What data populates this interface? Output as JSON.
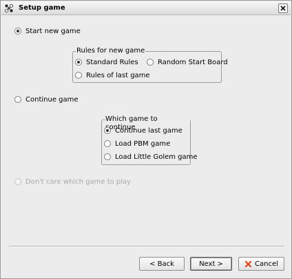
{
  "window": {
    "title": "Setup game"
  },
  "start_new": {
    "label": "Start new game",
    "selected": true
  },
  "rules_group": {
    "title": "Rules for new game",
    "options": [
      {
        "label": "Standard Rules",
        "selected": true
      },
      {
        "label": "Random Start Board",
        "selected": false
      },
      {
        "label": "Rules of last game",
        "selected": false
      }
    ]
  },
  "continue": {
    "label": "Continue game",
    "selected": false
  },
  "continue_group": {
    "title": "Which game to continue",
    "options": [
      {
        "label": "Continue last game",
        "selected": true
      },
      {
        "label": "Load PBM game",
        "selected": false
      },
      {
        "label": "Load Little Golem game",
        "selected": false
      }
    ]
  },
  "dont_care": {
    "label": "Don't care which game to play",
    "enabled": false
  },
  "buttons": {
    "back": "< Back",
    "next": "Next >",
    "cancel": "Cancel"
  },
  "colors": {
    "cancel_icon": "#d8461d"
  }
}
